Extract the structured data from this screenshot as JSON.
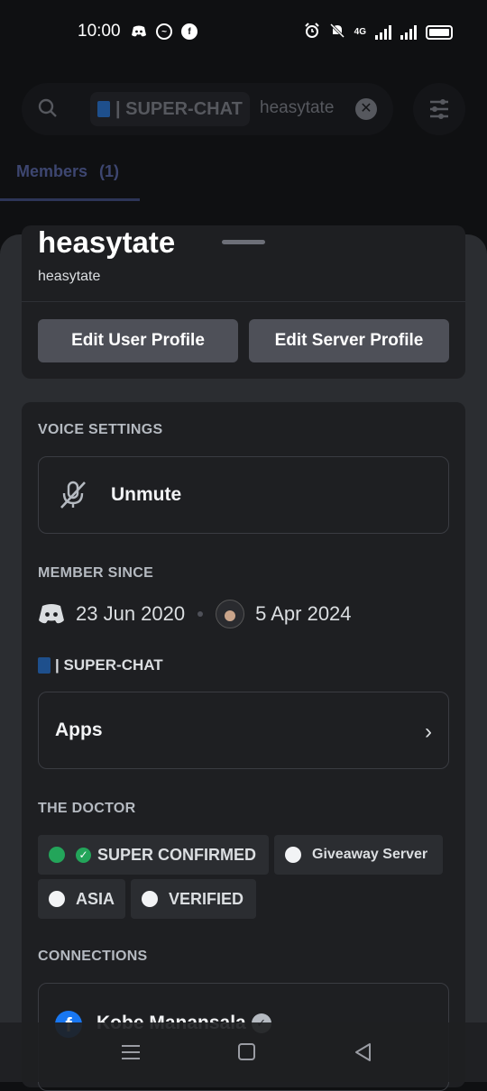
{
  "status_bar": {
    "time": "10:00",
    "network": "4G",
    "left_icons": [
      "discord-notification-icon",
      "messenger-icon",
      "facebook-icon"
    ],
    "right_icons": [
      "alarm-icon",
      "mute-icon",
      "signal-icon",
      "signal-icon",
      "battery-icon"
    ]
  },
  "background": {
    "search_chip": "| SUPER-CHAT",
    "search_query": "heasytate",
    "members_tab": "Members",
    "members_count": "(1)"
  },
  "profile": {
    "display_name": "heasytate",
    "username": "heasytate",
    "edit_user_profile": "Edit User Profile",
    "edit_server_profile": "Edit Server Profile"
  },
  "voice": {
    "section_label": "VOICE SETTINGS",
    "unmute_label": "Unmute"
  },
  "member_since": {
    "section_label": "MEMBER SINCE",
    "discord_date": "23 Jun 2020",
    "server_date": "5 Apr 2024"
  },
  "server": {
    "tag_label": "| SUPER-CHAT",
    "apps_label": "Apps"
  },
  "roles": {
    "section_label": "THE DOCTOR",
    "items": [
      {
        "label": "SUPER CONFIRMED",
        "color": "#23a55a"
      },
      {
        "label": "Giveaway Server",
        "color": "#f2f3f5"
      },
      {
        "label": "ASIA",
        "color": "#f2f3f5"
      },
      {
        "label": "VERIFIED",
        "color": "#f2f3f5"
      }
    ]
  },
  "connections": {
    "section_label": "CONNECTIONS",
    "items": [
      {
        "service": "facebook",
        "name": "Kobe Manansala",
        "verified": true
      }
    ]
  },
  "colors": {
    "accent": "#5865f2",
    "sheet_bg": "#2b2d31",
    "card_bg": "#1e1f22",
    "button_bg": "#4e5058"
  }
}
